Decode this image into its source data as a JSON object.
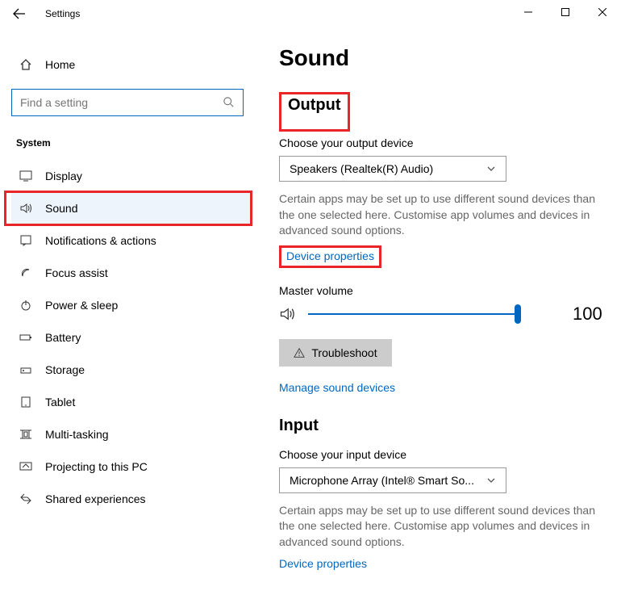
{
  "window": {
    "title": "Settings"
  },
  "sidebar": {
    "home": "Home",
    "search_placeholder": "Find a setting",
    "section": "System",
    "items": [
      {
        "label": "Display"
      },
      {
        "label": "Sound"
      },
      {
        "label": "Notifications & actions"
      },
      {
        "label": "Focus assist"
      },
      {
        "label": "Power & sleep"
      },
      {
        "label": "Battery"
      },
      {
        "label": "Storage"
      },
      {
        "label": "Tablet"
      },
      {
        "label": "Multi-tasking"
      },
      {
        "label": "Projecting to this PC"
      },
      {
        "label": "Shared experiences"
      }
    ]
  },
  "main": {
    "title": "Sound",
    "output": {
      "heading": "Output",
      "choose_label": "Choose your output device",
      "device": "Speakers (Realtek(R) Audio)",
      "desc": "Certain apps may be set up to use different sound devices than the one selected here. Customise app volumes and devices in advanced sound options.",
      "device_props": "Device properties",
      "master_volume": "Master volume",
      "volume_value": "100",
      "troubleshoot": "Troubleshoot",
      "manage": "Manage sound devices"
    },
    "input": {
      "heading": "Input",
      "choose_label": "Choose your input device",
      "device": "Microphone Array (Intel® Smart So...",
      "desc": "Certain apps may be set up to use different sound devices than the one selected here. Customise app volumes and devices in advanced sound options.",
      "device_props": "Device properties"
    }
  }
}
